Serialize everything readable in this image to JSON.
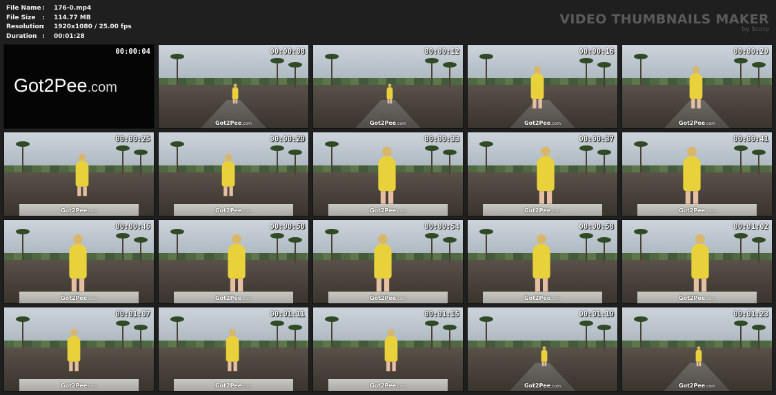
{
  "file_info": {
    "name_key": "File Name",
    "name_value": "176-0.mp4",
    "size_key": "File Size",
    "size_value": "114.77 MB",
    "res_key": "Resolution",
    "res_value": "1920x1080 / 25.00 fps",
    "dur_key": "Duration",
    "dur_value": "00:01:28",
    "separator": ":"
  },
  "brand": {
    "title": "VIDEO THUMBNAILS MAKER",
    "subtitle": "by Scorp"
  },
  "title_card": {
    "logo_main": "Got2Pee",
    "logo_tld": ".com"
  },
  "watermark": {
    "main": "Got2Pee",
    "tld": ".com"
  },
  "thumbnails": [
    {
      "time": "00:00:04"
    },
    {
      "time": "00:00:08"
    },
    {
      "time": "00:00:12"
    },
    {
      "time": "00:00:16"
    },
    {
      "time": "00:00:20"
    },
    {
      "time": "00:00:25"
    },
    {
      "time": "00:00:29"
    },
    {
      "time": "00:00:33"
    },
    {
      "time": "00:00:37"
    },
    {
      "time": "00:00:41"
    },
    {
      "time": "00:00:46"
    },
    {
      "time": "00:00:50"
    },
    {
      "time": "00:00:54"
    },
    {
      "time": "00:00:58"
    },
    {
      "time": "00:01:02"
    },
    {
      "time": "00:01:07"
    },
    {
      "time": "00:01:11"
    },
    {
      "time": "00:01:15"
    },
    {
      "time": "00:01:19"
    },
    {
      "time": "00:01:23"
    }
  ]
}
